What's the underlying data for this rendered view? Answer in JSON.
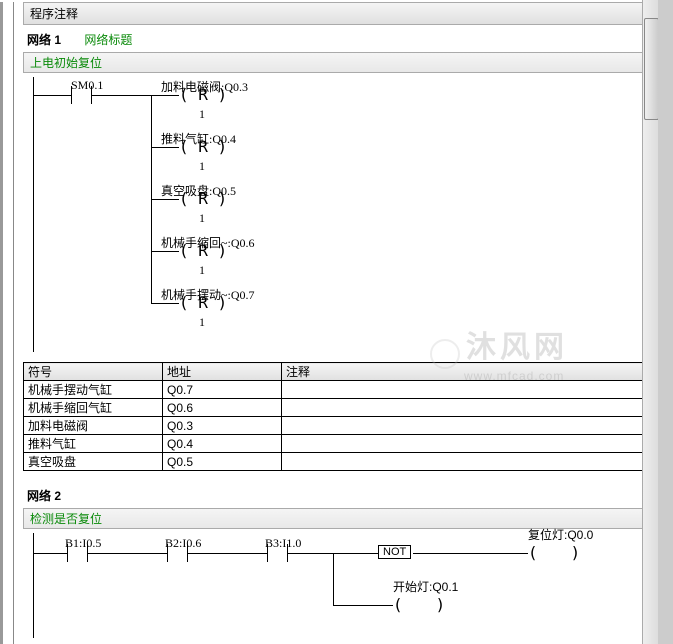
{
  "section_header": "程序注释",
  "network1": {
    "id": "网络 1",
    "title": "网络标题",
    "comment": "上电初始复位",
    "input_contact": {
      "symbol": "SM0.1"
    },
    "coils": [
      {
        "label": "加料电磁阀:Q0.3",
        "type": "R",
        "value": "1"
      },
      {
        "label": "推料气缸:Q0.4",
        "type": "R",
        "value": "1"
      },
      {
        "label": "真空吸盘:Q0.5",
        "type": "R",
        "value": "1"
      },
      {
        "label": "机械手缩回~:Q0.6",
        "type": "R",
        "value": "1"
      },
      {
        "label": "机械手摆动~:Q0.7",
        "type": "R",
        "value": "1"
      }
    ]
  },
  "symbol_table": {
    "headers": {
      "symbol": "符号",
      "address": "地址",
      "comment": "注释"
    },
    "rows": [
      {
        "symbol": "机械手摆动气缸",
        "address": "Q0.7",
        "comment": ""
      },
      {
        "symbol": "机械手缩回气缸",
        "address": "Q0.6",
        "comment": ""
      },
      {
        "symbol": "加料电磁阀",
        "address": "Q0.3",
        "comment": ""
      },
      {
        "symbol": "推料气缸",
        "address": "Q0.4",
        "comment": ""
      },
      {
        "symbol": "真空吸盘",
        "address": "Q0.5",
        "comment": ""
      }
    ]
  },
  "network2": {
    "id": "网络 2",
    "comment": "检测是否复位",
    "contacts": [
      {
        "label": "B1:I0.5"
      },
      {
        "label": "B2:I0.6"
      },
      {
        "label": "B3:I1.0"
      }
    ],
    "not_block": "NOT",
    "coils": [
      {
        "label": "复位灯:Q0.0"
      },
      {
        "label": "开始灯:Q0.1"
      }
    ]
  },
  "watermark": {
    "text": "沐风网",
    "url": "www.mfcad.com"
  }
}
